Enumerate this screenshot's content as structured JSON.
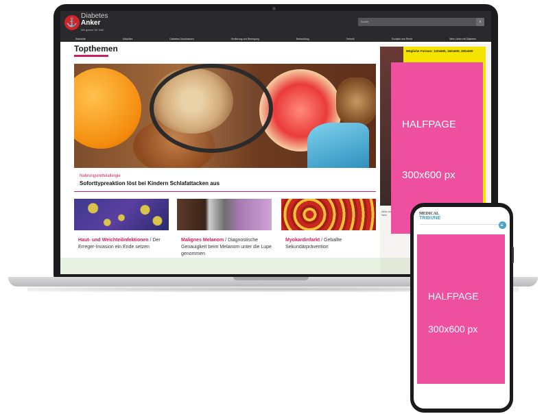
{
  "site": {
    "logo_title": "Diabetes",
    "logo_subtitle": "Anker",
    "logo_tagline": "Wir geben Dir Halt",
    "search_placeholder": "Suche",
    "nav": [
      "Startseite",
      "Aktuelles",
      "Diabetes-Grundwissen",
      "Ernährung und Bewegung",
      "Behandlung",
      "Technik",
      "Soziales und Recht",
      "Mein Leben mit Diabetes"
    ]
  },
  "main": {
    "section_title": "Topthemen",
    "hero": {
      "kicker": "Nahrungsmittelallergie",
      "headline": "Soforttypreaktion löst bei Kindern Schlafattacken aus"
    },
    "cards": [
      {
        "title": "Haut- und Weichteilinfektionen",
        "text": " / Der Erreger-Invasion ein Ende setzen"
      },
      {
        "title": "Malignes Melanom",
        "text": " / Diagnostische Genauigkeit beim Melanom unter die Lupe genommen"
      },
      {
        "title": "Myokardinfarkt",
        "text": " / Geballte Sekundärprävention"
      }
    ]
  },
  "sidebar": {
    "yellow_ad_text": "Mögliche Formen: 120x600, 160x600, 300x600",
    "small_label": "Alles rund um Diabetes im Netz"
  },
  "laptop_ad": {
    "label": "HALFPAGE",
    "size": "300x600 px",
    "color": "#ee4f9e"
  },
  "phone": {
    "logo_top": "MEDICAL",
    "logo_bottom": "TRIBUNE",
    "ad": {
      "label": "HALFPAGE",
      "size": "300x600 px",
      "color": "#ee4f9e"
    }
  },
  "colors": {
    "accent": "#c9205f",
    "ad_pink": "#ee4f9e",
    "header_dark": "#2a2a2c"
  }
}
